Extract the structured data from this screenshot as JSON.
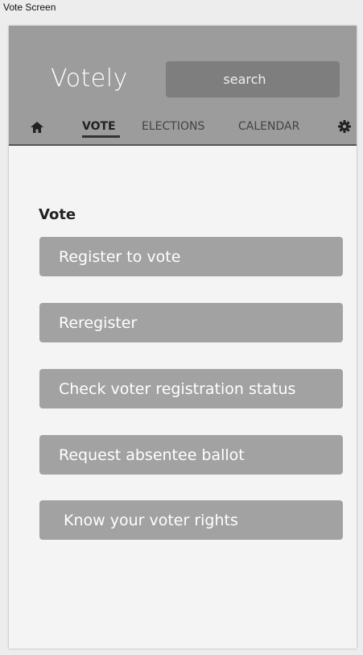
{
  "window": {
    "title": "Vote Screen"
  },
  "app": {
    "title": "Votely"
  },
  "search": {
    "placeholder": "search"
  },
  "nav": {
    "home_icon": "home-icon",
    "settings_icon": "gear-icon",
    "tabs": [
      {
        "label": "VOTE",
        "active": true
      },
      {
        "label": "ELECTIONS",
        "active": false
      },
      {
        "label": "CALENDAR",
        "active": false
      }
    ]
  },
  "main": {
    "heading": "Vote",
    "actions": [
      {
        "label": "Register to vote"
      },
      {
        "label": "Reregister"
      },
      {
        "label": "Check voter registration status"
      },
      {
        "label": "Request absentee ballot"
      },
      {
        "label": "Know your voter rights"
      }
    ]
  },
  "colors": {
    "header_bg": "#9c9c9c",
    "search_bg": "#7e7e7e",
    "button_bg": "#a2a2a2",
    "content_bg": "#f4f4f4"
  }
}
